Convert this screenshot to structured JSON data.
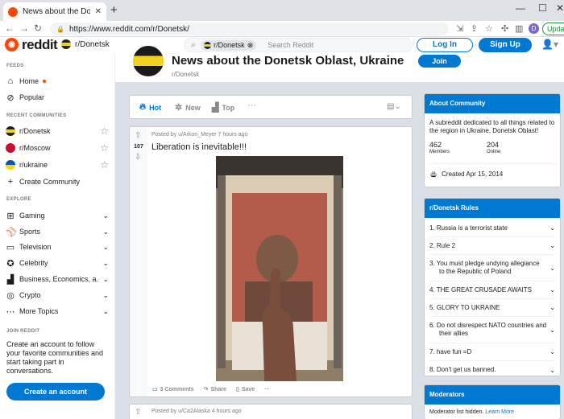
{
  "browser": {
    "tab_title": "News about the Donetsk Oblast",
    "url": "https://www.reddit.com/r/Donetsk/",
    "profile_initial": "D",
    "update_label": "Update"
  },
  "header": {
    "logo_text": "reddit",
    "current_sub": "r/Donetsk",
    "search_chip": "r/Donetsk",
    "search_placeholder": "Search Reddit",
    "login": "Log In",
    "signup": "Sign Up"
  },
  "sidebar": {
    "feeds_heading": "FEEDS",
    "feeds": [
      {
        "label": "Home",
        "icon": "home-icon"
      },
      {
        "label": "Popular",
        "icon": "popular-icon"
      }
    ],
    "recent_heading": "RECENT COMMUNITIES",
    "recent": [
      {
        "label": "r/Donetsk"
      },
      {
        "label": "r/Moscow"
      },
      {
        "label": "r/ukraine"
      }
    ],
    "create_community": "Create Community",
    "explore_heading": "EXPLORE",
    "explore": [
      {
        "label": "Gaming",
        "icon": "gamepad-icon"
      },
      {
        "label": "Sports",
        "icon": "sports-icon"
      },
      {
        "label": "Television",
        "icon": "tv-icon"
      },
      {
        "label": "Celebrity",
        "icon": "star-badge-icon"
      },
      {
        "label": "Business, Economics, a...",
        "icon": "chart-icon"
      },
      {
        "label": "Crypto",
        "icon": "crypto-icon"
      },
      {
        "label": "More Topics",
        "icon": "more-icon"
      }
    ],
    "join_heading": "JOIN REDDIT",
    "join_text": "Create an account to follow your favorite communities and start taking part in conversations.",
    "create_account": "Create an account"
  },
  "community": {
    "title": "News about the Donetsk Oblast, Ukraine",
    "name": "r/Donetsk",
    "join": "Join"
  },
  "sort": {
    "hot": "Hot",
    "new": "New",
    "top": "Top",
    "more": "···"
  },
  "post": {
    "meta": "Posted by u/Arkon_Meyer 7 hours ago",
    "votes": "107",
    "title": "Liberation is inevitable!!!",
    "comments": "3 Comments",
    "share": "Share",
    "save": "Save",
    "more": "···"
  },
  "post2": {
    "meta": "Posted by u/Ca2Alaska 4 hours ago"
  },
  "about": {
    "heading": "About Community",
    "description": "A subreddit dedicated to all things related to the region in Ukraine, Donetsk Oblast!",
    "members_count": "462",
    "members_label": "Members",
    "online_count": "204",
    "online_label": "Online",
    "created": "Created Apr 15, 2014"
  },
  "rules": {
    "heading": "r/Donetsk Rules",
    "items": [
      "1. Russia is a terrorist state",
      "2. Rule 2",
      "3. You must pledge undying allegiance to the Republic of Poland",
      "4. THE GREAT CRUSADE AWAITS",
      "5. GLORY TO UKRAINE",
      "6. Do not disrespect NATO countries and their allies",
      "7. have fun =D",
      "8. Don't get us banned."
    ]
  },
  "moderators": {
    "heading": "Moderators",
    "text": "Moderator list hidden.",
    "link": "Learn More"
  }
}
